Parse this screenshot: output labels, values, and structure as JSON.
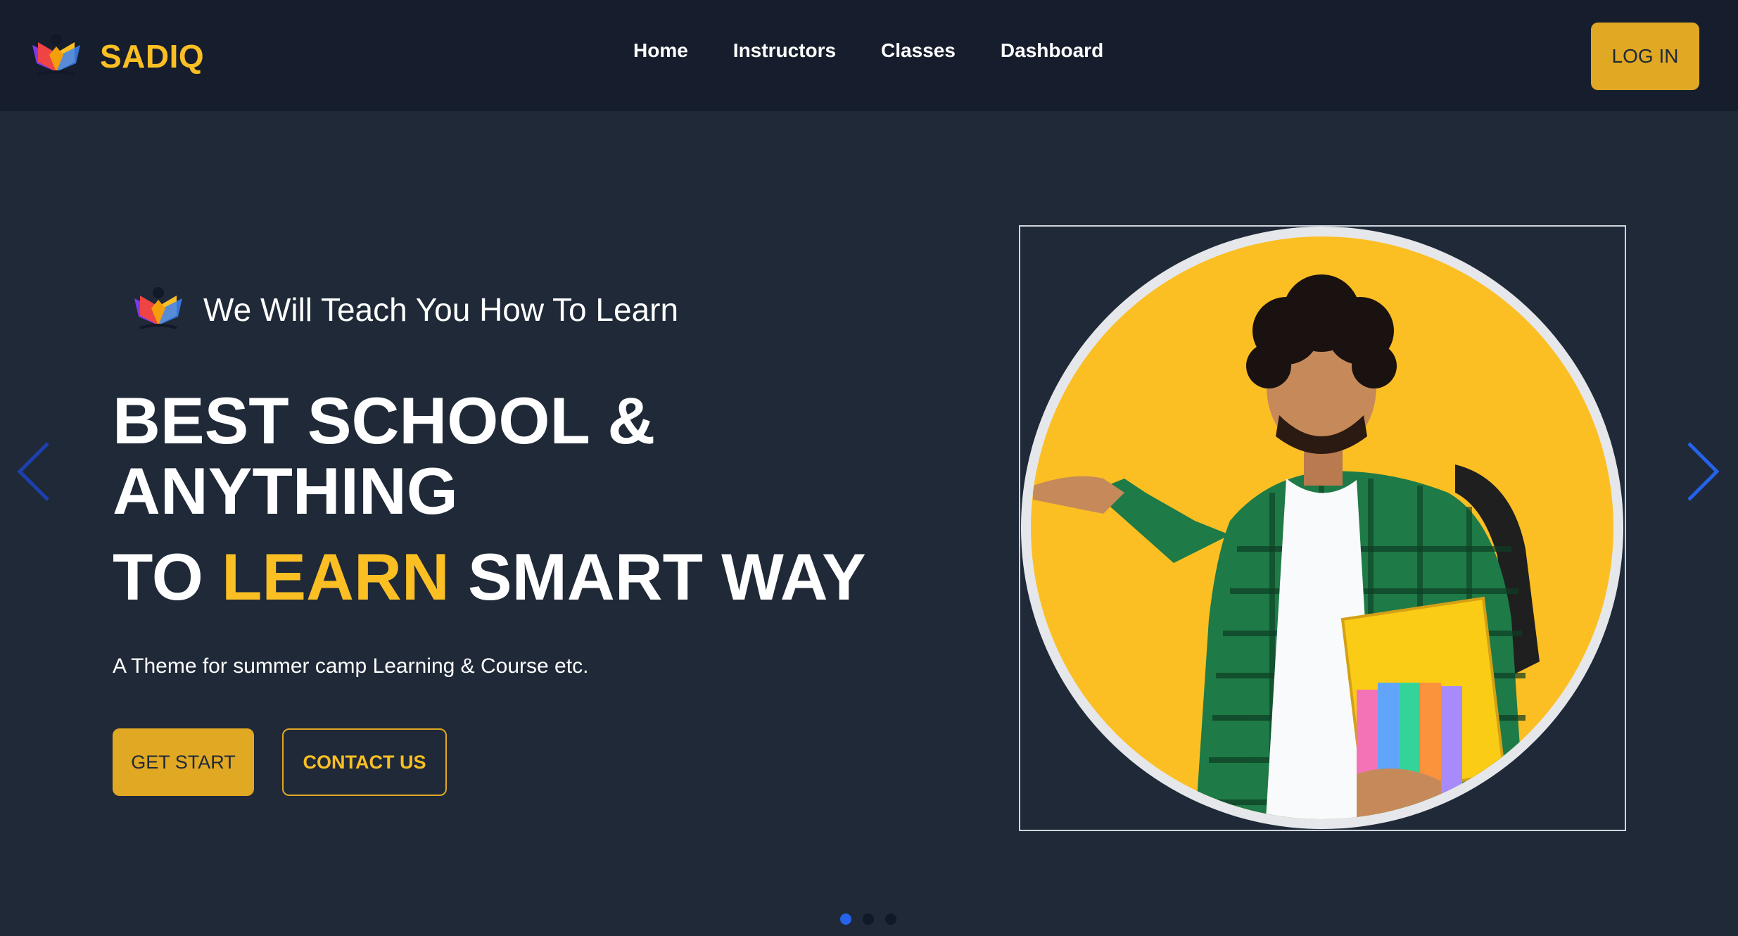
{
  "brand": {
    "name": "SADIQ",
    "logo_icon": "open-book-reader-logo"
  },
  "nav": {
    "items": [
      {
        "label": "Home"
      },
      {
        "label": "Instructors"
      },
      {
        "label": "Classes"
      },
      {
        "label": "Dashboard"
      }
    ],
    "login_label": "LOG IN"
  },
  "hero": {
    "tagline": "We Will Teach You How To Learn",
    "headline_line1": "BEST SCHOOL &",
    "headline_line2": "ANYTHING",
    "headline_line3_prefix": "TO",
    "headline_line3_accent": "LEARN",
    "headline_line3_suffix": "SMART WAY",
    "subtext": "A Theme for summer camp Learning & Course etc.",
    "primary_button": "GET START",
    "secondary_button": "CONTACT US",
    "image_icon": "student-with-books-photo"
  },
  "carousel": {
    "slide_count": 3,
    "active_slide": 1,
    "prev_icon": "chevron-left-icon",
    "next_icon": "chevron-right-icon"
  },
  "colors": {
    "background": "#1f2937",
    "navbar": "#161e2d",
    "accent": "#fbbf24",
    "button": "#e0a823",
    "arrow": "#2563eb"
  }
}
